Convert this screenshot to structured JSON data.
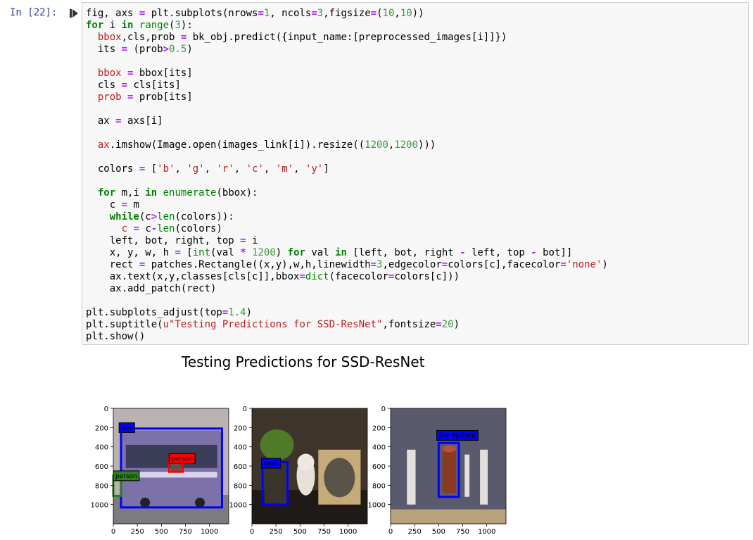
{
  "cell": {
    "prompt": "In [22]:",
    "run_icon": "run-cell-icon",
    "code_lines": [
      [
        {
          "t": "fig, axs ",
          "c": "n"
        },
        {
          "t": "=",
          "c": "o"
        },
        {
          "t": " plt.subplots(nrows",
          "c": "n"
        },
        {
          "t": "=",
          "c": "o"
        },
        {
          "t": "1",
          "c": "m"
        },
        {
          "t": ", ncols",
          "c": "n"
        },
        {
          "t": "=",
          "c": "o"
        },
        {
          "t": "3",
          "c": "m"
        },
        {
          "t": ",figsize",
          "c": "n"
        },
        {
          "t": "=",
          "c": "o"
        },
        {
          "t": "(",
          "c": "n"
        },
        {
          "t": "10",
          "c": "m"
        },
        {
          "t": ",",
          "c": "n"
        },
        {
          "t": "10",
          "c": "m"
        },
        {
          "t": "))",
          "c": "n"
        }
      ],
      [
        {
          "t": "for",
          "c": "k"
        },
        {
          "t": " i ",
          "c": "n"
        },
        {
          "t": "in",
          "c": "k"
        },
        {
          "t": " ",
          "c": "n"
        },
        {
          "t": "range",
          "c": "nb"
        },
        {
          "t": "(",
          "c": "n"
        },
        {
          "t": "3",
          "c": "m"
        },
        {
          "t": "):",
          "c": "n"
        }
      ],
      [
        {
          "t": "  ",
          "c": "n"
        },
        {
          "t": "bbox",
          "c": "v"
        },
        {
          "t": ",cls,prob ",
          "c": "n"
        },
        {
          "t": "=",
          "c": "o"
        },
        {
          "t": " bk_obj.predict({input_name:[preprocessed_images[i]]})",
          "c": "n"
        }
      ],
      [
        {
          "t": "  its ",
          "c": "n"
        },
        {
          "t": "=",
          "c": "o"
        },
        {
          "t": " (prob",
          "c": "n"
        },
        {
          "t": ">",
          "c": "o"
        },
        {
          "t": "0.5",
          "c": "m"
        },
        {
          "t": ")",
          "c": "n"
        }
      ],
      [],
      [
        {
          "t": "  ",
          "c": "n"
        },
        {
          "t": "bbox",
          "c": "v"
        },
        {
          "t": " ",
          "c": "n"
        },
        {
          "t": "=",
          "c": "o"
        },
        {
          "t": " bbox[its]",
          "c": "n"
        }
      ],
      [
        {
          "t": "  cls ",
          "c": "n"
        },
        {
          "t": "=",
          "c": "o"
        },
        {
          "t": " cls[its]",
          "c": "n"
        }
      ],
      [
        {
          "t": "  ",
          "c": "n"
        },
        {
          "t": "prob",
          "c": "v"
        },
        {
          "t": " ",
          "c": "n"
        },
        {
          "t": "=",
          "c": "o"
        },
        {
          "t": " prob[its]",
          "c": "n"
        }
      ],
      [],
      [
        {
          "t": "  ax ",
          "c": "n"
        },
        {
          "t": "=",
          "c": "o"
        },
        {
          "t": " axs[i]",
          "c": "n"
        }
      ],
      [],
      [
        {
          "t": "  ",
          "c": "n"
        },
        {
          "t": "ax",
          "c": "v"
        },
        {
          "t": ".imshow(Image.open(images_link[i]).resize((",
          "c": "n"
        },
        {
          "t": "1200",
          "c": "m"
        },
        {
          "t": ",",
          "c": "n"
        },
        {
          "t": "1200",
          "c": "m"
        },
        {
          "t": ")))",
          "c": "n"
        }
      ],
      [],
      [
        {
          "t": "  colors ",
          "c": "n"
        },
        {
          "t": "=",
          "c": "o"
        },
        {
          "t": " [",
          "c": "n"
        },
        {
          "t": "'b'",
          "c": "s"
        },
        {
          "t": ", ",
          "c": "n"
        },
        {
          "t": "'g'",
          "c": "s"
        },
        {
          "t": ", ",
          "c": "n"
        },
        {
          "t": "'r'",
          "c": "s"
        },
        {
          "t": ", ",
          "c": "n"
        },
        {
          "t": "'c'",
          "c": "s"
        },
        {
          "t": ", ",
          "c": "n"
        },
        {
          "t": "'m'",
          "c": "s"
        },
        {
          "t": ", ",
          "c": "n"
        },
        {
          "t": "'y'",
          "c": "s"
        },
        {
          "t": "]",
          "c": "n"
        }
      ],
      [],
      [
        {
          "t": "  ",
          "c": "n"
        },
        {
          "t": "for",
          "c": "k"
        },
        {
          "t": " m,i ",
          "c": "n"
        },
        {
          "t": "in",
          "c": "k"
        },
        {
          "t": " ",
          "c": "n"
        },
        {
          "t": "enumerate",
          "c": "nb"
        },
        {
          "t": "(bbox):",
          "c": "n"
        }
      ],
      [
        {
          "t": "    c ",
          "c": "n"
        },
        {
          "t": "=",
          "c": "o"
        },
        {
          "t": " m",
          "c": "n"
        }
      ],
      [
        {
          "t": "    ",
          "c": "n"
        },
        {
          "t": "while",
          "c": "k"
        },
        {
          "t": "(c",
          "c": "n"
        },
        {
          "t": ">",
          "c": "o"
        },
        {
          "t": "len",
          "c": "nb"
        },
        {
          "t": "(colors)):",
          "c": "n"
        }
      ],
      [
        {
          "t": "      ",
          "c": "n"
        },
        {
          "t": "c",
          "c": "v"
        },
        {
          "t": " ",
          "c": "n"
        },
        {
          "t": "=",
          "c": "o"
        },
        {
          "t": " c",
          "c": "n"
        },
        {
          "t": "-",
          "c": "o"
        },
        {
          "t": "len",
          "c": "nb"
        },
        {
          "t": "(colors)",
          "c": "n"
        }
      ],
      [
        {
          "t": "    left, bot, right, top ",
          "c": "n"
        },
        {
          "t": "=",
          "c": "o"
        },
        {
          "t": " i",
          "c": "n"
        }
      ],
      [
        {
          "t": "    x, y, w, h ",
          "c": "n"
        },
        {
          "t": "=",
          "c": "o"
        },
        {
          "t": " [",
          "c": "n"
        },
        {
          "t": "int",
          "c": "nb"
        },
        {
          "t": "(val ",
          "c": "n"
        },
        {
          "t": "*",
          "c": "o"
        },
        {
          "t": " ",
          "c": "n"
        },
        {
          "t": "1200",
          "c": "m"
        },
        {
          "t": ") ",
          "c": "n"
        },
        {
          "t": "for",
          "c": "k"
        },
        {
          "t": " val ",
          "c": "n"
        },
        {
          "t": "in",
          "c": "k"
        },
        {
          "t": " [left, bot, right ",
          "c": "n"
        },
        {
          "t": "-",
          "c": "o"
        },
        {
          "t": " left, top ",
          "c": "n"
        },
        {
          "t": "-",
          "c": "o"
        },
        {
          "t": " bot]]",
          "c": "n"
        }
      ],
      [
        {
          "t": "    rect ",
          "c": "n"
        },
        {
          "t": "=",
          "c": "o"
        },
        {
          "t": " patches.Rectangle((x,y),w,h,linewidth",
          "c": "n"
        },
        {
          "t": "=",
          "c": "o"
        },
        {
          "t": "3",
          "c": "m"
        },
        {
          "t": ",edgecolor",
          "c": "n"
        },
        {
          "t": "=",
          "c": "o"
        },
        {
          "t": "colors[c],facecolor",
          "c": "n"
        },
        {
          "t": "=",
          "c": "o"
        },
        {
          "t": "'none'",
          "c": "s"
        },
        {
          "t": ")",
          "c": "n"
        }
      ],
      [
        {
          "t": "    ax.text(x,y,classes[cls[c]],bbox",
          "c": "n"
        },
        {
          "t": "=",
          "c": "o"
        },
        {
          "t": "dict",
          "c": "nb"
        },
        {
          "t": "(facecolor",
          "c": "n"
        },
        {
          "t": "=",
          "c": "o"
        },
        {
          "t": "colors[c]))",
          "c": "n"
        }
      ],
      [
        {
          "t": "    ax.add_patch(rect)",
          "c": "n"
        }
      ],
      [],
      [
        {
          "t": "plt.subplots_adjust(top",
          "c": "n"
        },
        {
          "t": "=",
          "c": "o"
        },
        {
          "t": "1.4",
          "c": "m"
        },
        {
          "t": ")",
          "c": "n"
        }
      ],
      [
        {
          "t": "plt.suptitle(",
          "c": "n"
        },
        {
          "t": "u\"Testing Predictions for SSD-ResNet\"",
          "c": "s"
        },
        {
          "t": ",fontsize",
          "c": "n"
        },
        {
          "t": "=",
          "c": "o"
        },
        {
          "t": "20",
          "c": "m"
        },
        {
          "t": ")",
          "c": "n"
        }
      ],
      [
        {
          "t": "plt.show()",
          "c": "n"
        }
      ]
    ]
  },
  "output": {
    "suptitle": "Testing Predictions for SSD-ResNet",
    "chart_data": [
      {
        "type": "image",
        "xlim": [
          0,
          1200
        ],
        "ylim": [
          1200,
          0
        ],
        "xticks": [
          0,
          250,
          500,
          750,
          1000
        ],
        "yticks": [
          0,
          200,
          400,
          600,
          800,
          1000
        ],
        "boxes": [
          {
            "label": "bus",
            "color": "#0000ff",
            "x": [
              80,
              1130
            ],
            "y": [
              210,
              1030
            ],
            "label_at": [
              60,
              150
            ]
          },
          {
            "label": "person",
            "color": "#ff0000",
            "x": [
              580,
              720
            ],
            "y": [
              530,
              660
            ],
            "label_at": [
              580,
              470
            ]
          },
          {
            "label": "person",
            "color": "#2e7d1e",
            "x": [
              0,
              80
            ],
            "y": [
              700,
              910
            ],
            "label_at": [
              0,
              650
            ]
          }
        ]
      },
      {
        "type": "image",
        "xlim": [
          0,
          1200
        ],
        "ylim": [
          1200,
          0
        ],
        "xticks": [
          0,
          250,
          500,
          750,
          1000
        ],
        "yticks": [
          0,
          200,
          400,
          600,
          800,
          1000
        ],
        "boxes": [
          {
            "label": "vase",
            "color": "#0000ff",
            "x": [
              110,
              370
            ],
            "y": [
              560,
              1000
            ],
            "label_at": [
              100,
              520
            ]
          }
        ]
      },
      {
        "type": "image",
        "xlim": [
          0,
          1200
        ],
        "ylim": [
          1200,
          0
        ],
        "xticks": [
          0,
          250,
          500,
          750,
          1000
        ],
        "yticks": [
          0,
          200,
          400,
          600,
          800,
          1000
        ],
        "boxes": [
          {
            "label": "fire hydrant",
            "color": "#0000ff",
            "x": [
              500,
              710
            ],
            "y": [
              360,
              920
            ],
            "label_at": [
              480,
              230
            ]
          }
        ]
      }
    ]
  }
}
